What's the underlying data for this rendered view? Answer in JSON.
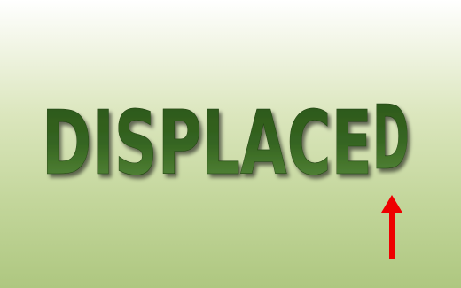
{
  "word": {
    "main_text": "DISPLACE",
    "displaced_letter": "D"
  },
  "colors": {
    "text_top": "#2d5a1a",
    "text_bottom": "#5a8a3a",
    "text_shadow": "#1a3010",
    "arrow": "#ee0000",
    "background_top": "#ffffff",
    "background_bottom": "#aec780"
  },
  "icons": {
    "pointer": "up-arrow-icon"
  }
}
